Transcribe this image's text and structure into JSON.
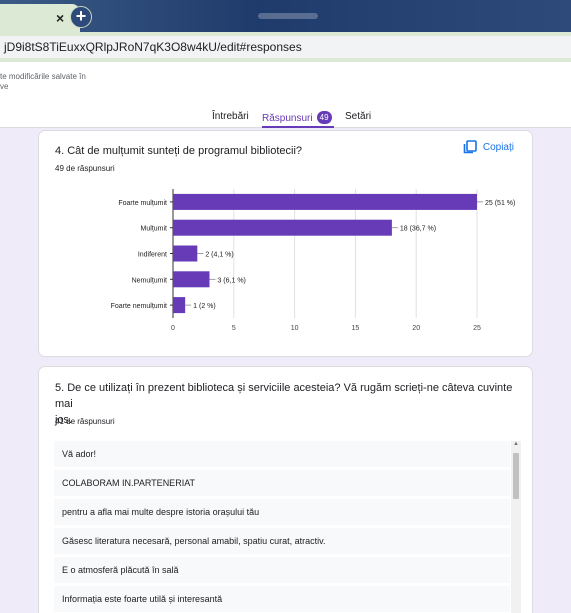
{
  "browser": {
    "tab_close_glyph": "×",
    "new_tab_glyph": "+",
    "url": "jD9i8tS8TiEuxxQRlpJRoN7qK3O8w4kU/edit#responses"
  },
  "forms": {
    "saved_message_line1": "te modificările salvate în",
    "saved_message_line2": "ve",
    "tabs": [
      {
        "label": "Întrebări"
      },
      {
        "label": "Răspunsuri",
        "badge": "49"
      },
      {
        "label": "Setări"
      }
    ],
    "accent_color": "#673ab7"
  },
  "question4": {
    "title": "4. Cât de mulțumit sunteți de programul bibliotecii?",
    "count": "49 de răspunsuri",
    "copy_label": "Copiați"
  },
  "chart_data": {
    "type": "bar",
    "orientation": "horizontal",
    "categories": [
      "Foarte mulțumit",
      "Mulțumit",
      "Indiferent",
      "Nemulțumit",
      "Foarte nemulțumit"
    ],
    "values": [
      25,
      18,
      2,
      3,
      1
    ],
    "data_labels": [
      "25 (51 %)",
      "18 (36,7 %)",
      "2 (4,1 %)",
      "3 (6,1 %)",
      "1 (2 %)"
    ],
    "xlim": [
      0,
      25
    ],
    "xticks": [
      "0",
      "5",
      "10",
      "15",
      "20",
      "25"
    ],
    "bar_color": "#673ab7",
    "grid": true
  },
  "question5": {
    "title_line1": "5. De ce utilizați în prezent biblioteca și serviciile acesteia? Vă rugăm scrieți-ne câteva cuvinte mai",
    "title_line2": "jos.",
    "count": "41 de răspunsuri",
    "responses": [
      "Vă ador!",
      "COLABORAM IN.PARTENERIAT",
      "pentru a afla mai multe despre istoria orașului tău",
      "Găsesc literatura necesară, personal amabil, spatiu curat, atractiv.",
      "E o atmosferă plăcută în sală",
      "Informația este foarte utilă și interesantă"
    ]
  }
}
